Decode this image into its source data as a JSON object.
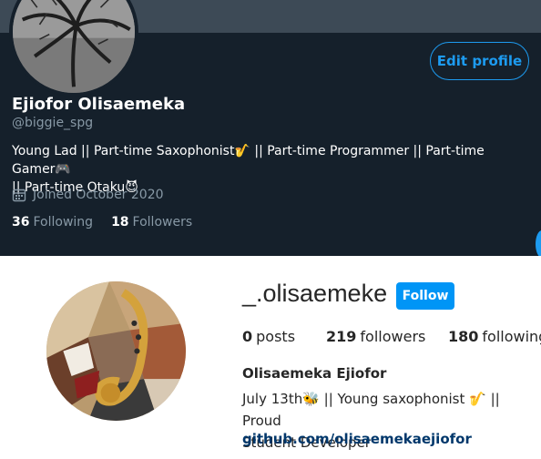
{
  "twitter": {
    "edit_profile_label": "Edit profile",
    "display_name": "Ejiofor Olisaemeka",
    "handle": "@biggie_spg",
    "bio_line1": "Young Lad || Part-time Saxophonist🎷 || Part-time Programmer || Part-time Gamer🎮",
    "bio_line2": "|| Part-time Otaku😈",
    "joined": "Joined October 2020",
    "following_count": "36",
    "following_label": "Following",
    "followers_count": "18",
    "followers_label": "Followers",
    "icons": [
      "calendar-icon"
    ],
    "colors": {
      "background": "#15202b",
      "accent": "#1d9bf0",
      "muted": "#8899a6"
    }
  },
  "instagram": {
    "username": "_.olisaemeke",
    "follow_label": "Follow",
    "posts_count": "0",
    "posts_label": "posts",
    "followers_count": "219",
    "followers_label": "followers",
    "following_count": "180",
    "following_label": "following",
    "full_name": "Olisaemeka Ejiofor",
    "bio_line1": "July 13th🐝 || Young saxophonist 🎷 || Proud",
    "bio_line2": "Student Developer",
    "link": "github.com/olisaemekaejiofor",
    "colors": {
      "follow_button": "#0095f6",
      "link": "#00376b",
      "text": "#262626"
    }
  }
}
